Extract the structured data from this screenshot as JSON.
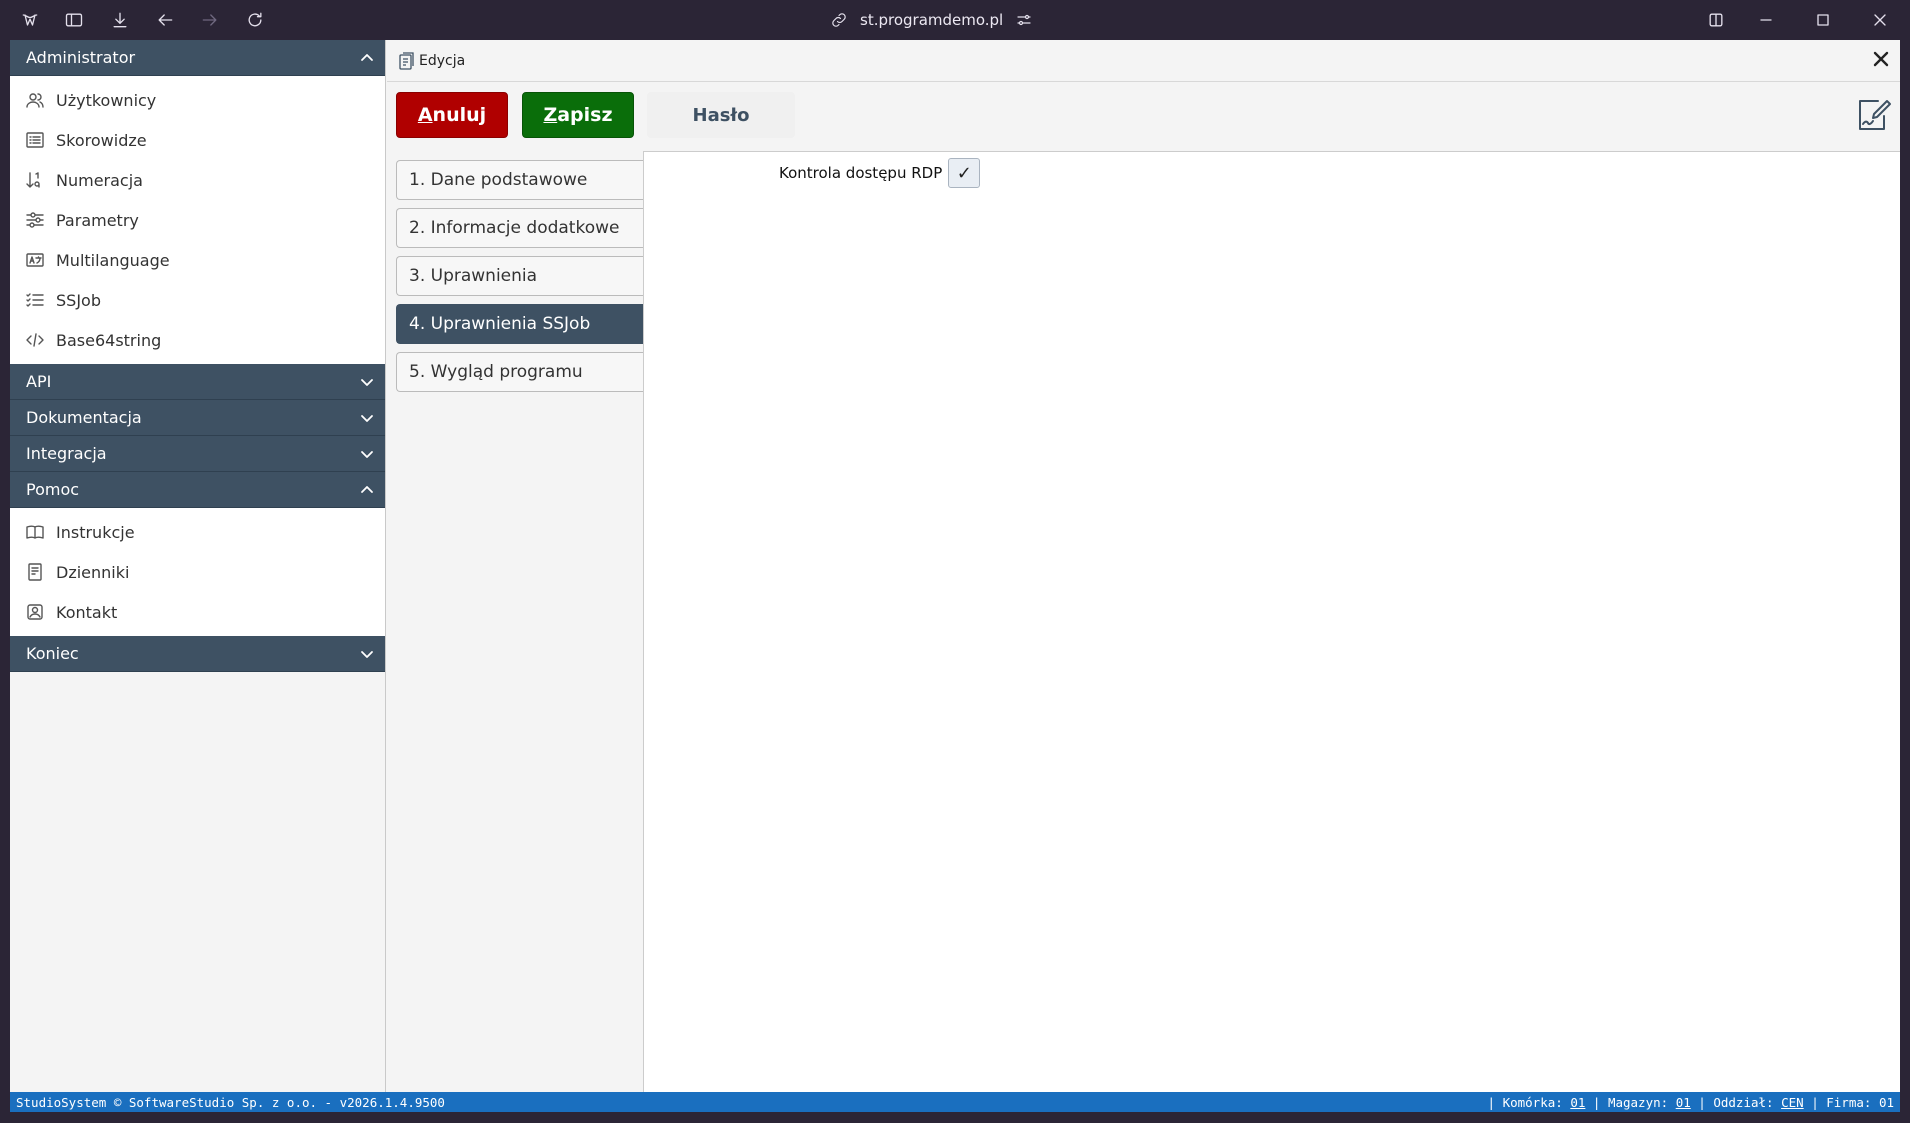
{
  "browser": {
    "url": "st.programdemo.pl"
  },
  "sidebar": {
    "sections": [
      {
        "label": "Administrator",
        "expanded": true
      },
      {
        "label": "API",
        "expanded": false
      },
      {
        "label": "Dokumentacja",
        "expanded": false
      },
      {
        "label": "Integracja",
        "expanded": false
      },
      {
        "label": "Pomoc",
        "expanded": true
      },
      {
        "label": "Koniec",
        "expanded": false
      }
    ],
    "admin_items": [
      {
        "label": "Użytkownicy",
        "icon": "users-icon"
      },
      {
        "label": "Skorowidze",
        "icon": "list-icon"
      },
      {
        "label": "Numeracja",
        "icon": "sort-numeric-icon"
      },
      {
        "label": "Parametry",
        "icon": "sliders-icon"
      },
      {
        "label": "Multilanguage",
        "icon": "translate-icon"
      },
      {
        "label": "SSJob",
        "icon": "checklist-icon"
      },
      {
        "label": "Base64string",
        "icon": "code-icon"
      }
    ],
    "help_items": [
      {
        "label": "Instrukcje",
        "icon": "book-icon"
      },
      {
        "label": "Dzienniki",
        "icon": "journal-icon"
      },
      {
        "label": "Kontakt",
        "icon": "contact-icon"
      }
    ]
  },
  "panel": {
    "title": "Edycja",
    "buttons": {
      "cancel_first": "A",
      "cancel_rest": "nuluj",
      "save_first": "Z",
      "save_rest": "apisz",
      "password": "Hasło"
    },
    "tabs": [
      {
        "label": "1. Dane podstawowe",
        "active": false
      },
      {
        "label": "2. Informacje dodatkowe",
        "active": false
      },
      {
        "label": "3. Uprawnienia",
        "active": false
      },
      {
        "label": "4. Uprawnienia SSJob",
        "active": true
      },
      {
        "label": "5. Wygląd programu",
        "active": false
      }
    ],
    "field": {
      "label": "Kontrola dostępu RDP",
      "checked": true,
      "check_glyph": "✓"
    }
  },
  "status": {
    "left": "StudioSystem © SoftwareStudio Sp. z o.o. - v2026.1.4.9500",
    "komorka_label": "Komórka:",
    "komorka_value": "01",
    "magazyn_label": "Magazyn:",
    "magazyn_value": "01",
    "oddzial_label": "Oddział:",
    "oddzial_value": "CEN",
    "firma_label": "Firma:",
    "firma_value": "01"
  },
  "colors": {
    "sidebar_header": "#3e5163",
    "cancel": "#b00000",
    "save": "#0a6e0a",
    "statusbar": "#1a6fbf"
  }
}
